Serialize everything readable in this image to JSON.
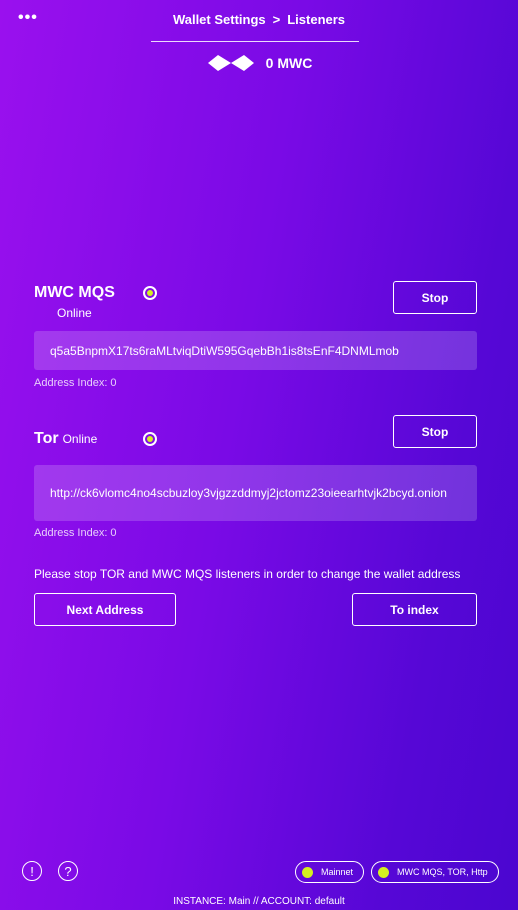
{
  "header": {
    "menu_label": "•••",
    "breadcrumb_parent": "Wallet Settings",
    "breadcrumb_sep": ">",
    "breadcrumb_current": "Listeners",
    "balance": "0 MWC"
  },
  "mqs": {
    "title": "MWC MQS",
    "status": "Online",
    "button": "Stop",
    "address": "q5a5BnpmX17ts6raMLtviqDtiW595GqebBh1is8tsEnF4DNMLmob",
    "address_index": "Address Index: 0"
  },
  "tor": {
    "title": "Tor",
    "status": "Online",
    "button": "Stop",
    "address": "http://ck6vlomc4no4scbuzloy3vjgzzddmyj2jctomz23oieearhtvjk2bcyd.onion",
    "address_index": "Address Index: 0"
  },
  "note": "Please stop TOR and MWC MQS listeners in order to change the wallet address",
  "buttons": {
    "next_address": "Next Address",
    "to_index": "To index"
  },
  "bottom": {
    "info_icon": "!",
    "help_icon": "?",
    "network_pill": "Mainnet",
    "listeners_pill": "MWC MQS, TOR, Http",
    "footer": "INSTANCE:  Main  //  ACCOUNT:  default"
  },
  "colors": {
    "status_dot": "#d4f020",
    "bg_left": "#9a10ee",
    "bg_right": "#4b06d0"
  }
}
